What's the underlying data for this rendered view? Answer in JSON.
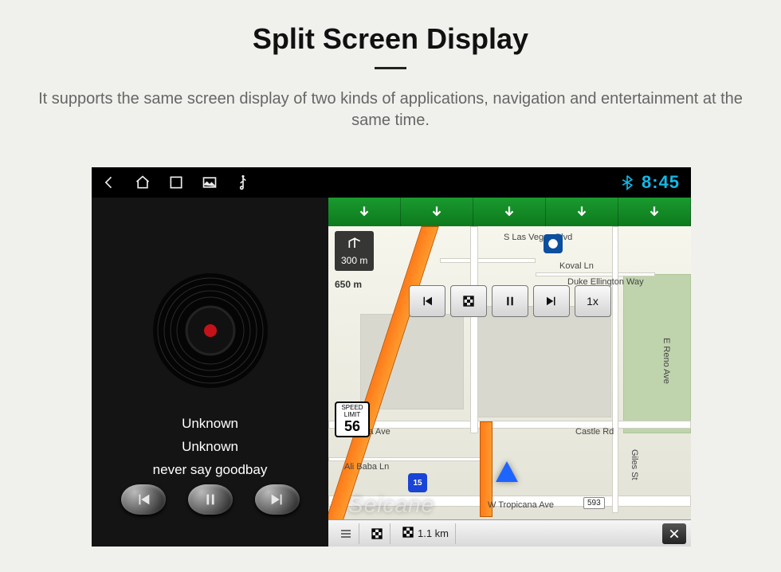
{
  "marketing": {
    "title": "Split Screen Display",
    "subtitle": "It supports the same screen display of two kinds of applications, navigation and entertainment at the same time."
  },
  "statusbar": {
    "clock": "8:45"
  },
  "music": {
    "line1": "Unknown",
    "line2": "Unknown",
    "line3": "never say goodbay"
  },
  "nav": {
    "turn_sign_top": "300 m",
    "turn_meta": "650 m",
    "speed_label_1": "SPEED",
    "speed_label_2": "LIMIT",
    "speed_value": "56",
    "speed_button": "1x",
    "shield_i15": "15",
    "streets": {
      "s_las_vegas": "S Las Vegas Blvd",
      "koval": "Koval Ln",
      "duke": "Duke Ellington Way",
      "hacienda": "Hacienda Ave",
      "ali_baba": "Ali Baba Ln",
      "castle": "Castle Rd",
      "w_tropicana": "W Tropicana Ave",
      "e_reno": "E Reno Ave",
      "giles": "Giles St"
    },
    "badge_593": "593",
    "bottom_dist": "1.1 km"
  },
  "watermark": "Seicane"
}
